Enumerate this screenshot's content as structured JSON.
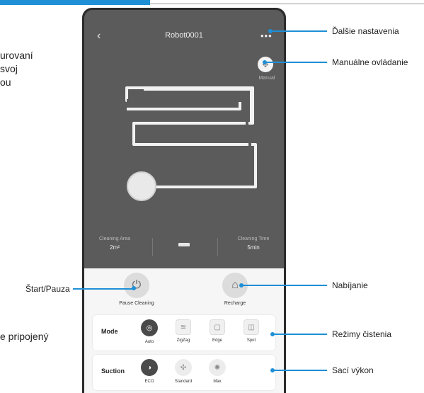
{
  "side": {
    "line1": "urovaní",
    "line2": "svoj",
    "line3": "ou",
    "line4": "e pripojený"
  },
  "app": {
    "back_icon": "‹",
    "robot_name": "Robot0001",
    "more_icon": "•••",
    "manual_label": "Manual",
    "cleaning_area_label": "Cleaning Area",
    "cleaning_area_value": "2m²",
    "cleaning_time_label": "Cleaning Time",
    "cleaning_time_value": "5min",
    "pause_label": "Pause Cleaning",
    "recharge_label": "Recharge",
    "mode": {
      "title": "Mode",
      "options": [
        "Auto",
        "ZigZag",
        "Edge",
        "Spot"
      ],
      "selected": "Auto"
    },
    "suction": {
      "title": "Suction",
      "options": [
        "ECO",
        "Standard",
        "Max"
      ],
      "selected": "ECO"
    }
  },
  "callouts": {
    "settings": "Ďalšie nastavenia",
    "manual": "Manuálne ovládanie",
    "start_pause": "Štart/Pauza",
    "charging": "Nabíjanie",
    "modes": "Režimy čistenia",
    "suction": "Sací výkon"
  },
  "colors": {
    "accent": "#1f8fd6",
    "map_bg": "#5b5b5b",
    "panel_bg": "#f6f6f6"
  }
}
